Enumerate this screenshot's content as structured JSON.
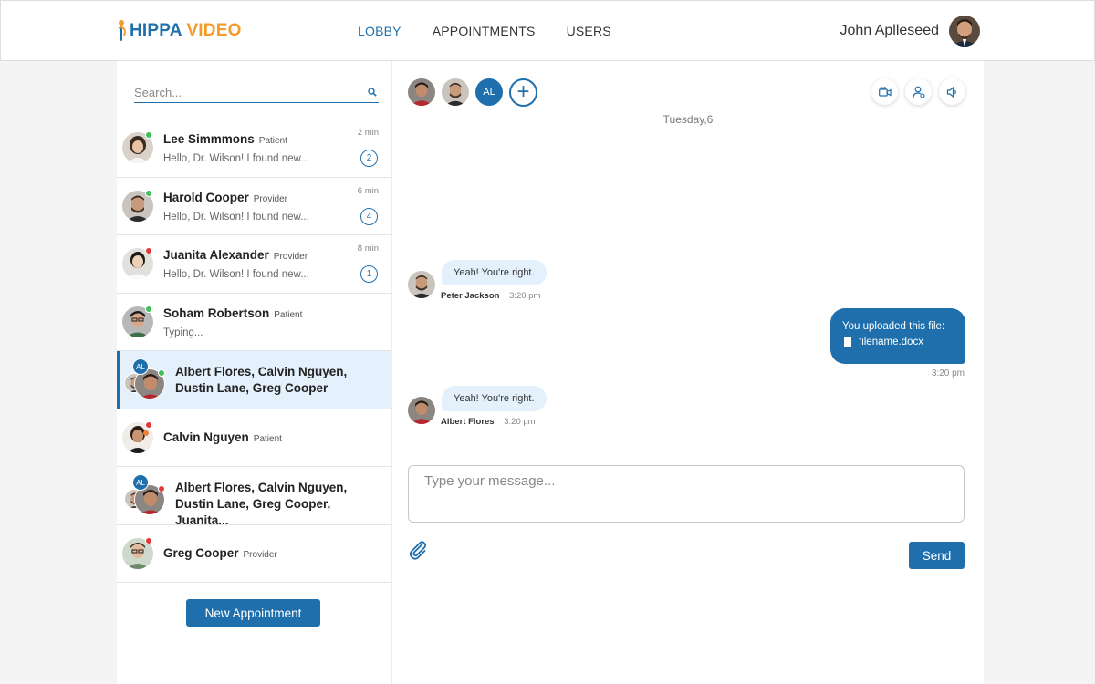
{
  "header": {
    "logo_part1": "HIPPA",
    "logo_part2": "VIDEO",
    "nav": [
      "LOBBY",
      "APPOINTMENTS",
      "USERS"
    ],
    "user_name": "John Aplleseed"
  },
  "sidebar": {
    "search_placeholder": "Search...",
    "conversations": [
      {
        "name": "Lee Simmmons",
        "role": "Patient",
        "preview": "Hello, Dr. Wilson!  I found new...",
        "time": "2 min",
        "unread": "2",
        "status": "green"
      },
      {
        "name": "Harold Cooper",
        "role": "Provider",
        "preview": "Hello, Dr. Wilson!  I found new...",
        "time": "6 min",
        "unread": "4",
        "status": "green"
      },
      {
        "name": "Juanita Alexander",
        "role": "Provider",
        "preview": "Hello, Dr. Wilson!  I found new...",
        "time": "8 min",
        "unread": "1",
        "status": "red"
      },
      {
        "name": "Soham Robertson",
        "role": "Patient",
        "preview": "Typing...",
        "status": "green"
      },
      {
        "group_name": "Albert Flores, Calvin Nguyen, Dustin Lane, Greg Cooper",
        "initials": "AL",
        "status": "green",
        "selected": true
      },
      {
        "name": "Calvin Nguyen",
        "role": "Patient",
        "status": "red"
      },
      {
        "group_name": "Albert Flores, Calvin Nguyen, Dustin Lane, Greg Cooper, Juanita...",
        "initials": "AL",
        "status": "red"
      },
      {
        "name": "Greg Cooper",
        "role": "Provider",
        "status": "red"
      }
    ],
    "new_appointment_label": "New Appointment"
  },
  "chat": {
    "participant_initials": "AL",
    "add_symbol": "+",
    "date_label": "Tuesday,6",
    "messages": [
      {
        "direction": "in",
        "text": "Yeah! You're right.",
        "sender": "Peter Jackson",
        "time": "3:20 pm"
      },
      {
        "direction": "out",
        "text": "You uploaded this file:",
        "file": "filename.docx",
        "time": "3:20 pm"
      },
      {
        "direction": "in",
        "text": "Yeah! You're right.",
        "sender": "Albert Flores",
        "time": "3:20 pm"
      }
    ],
    "composer_placeholder": "Type your message...",
    "send_label": "Send"
  },
  "colors": {
    "accent": "#1f6fad",
    "brand_orange": "#f39c2b",
    "online": "#3ec05a",
    "offline": "#e23a3a",
    "selected_bg": "#e4f1fc"
  },
  "icons": [
    "search-icon",
    "video-camera-icon",
    "user-settings-icon",
    "speaker-icon",
    "paperclip-icon",
    "file-icon",
    "plus-icon"
  ]
}
